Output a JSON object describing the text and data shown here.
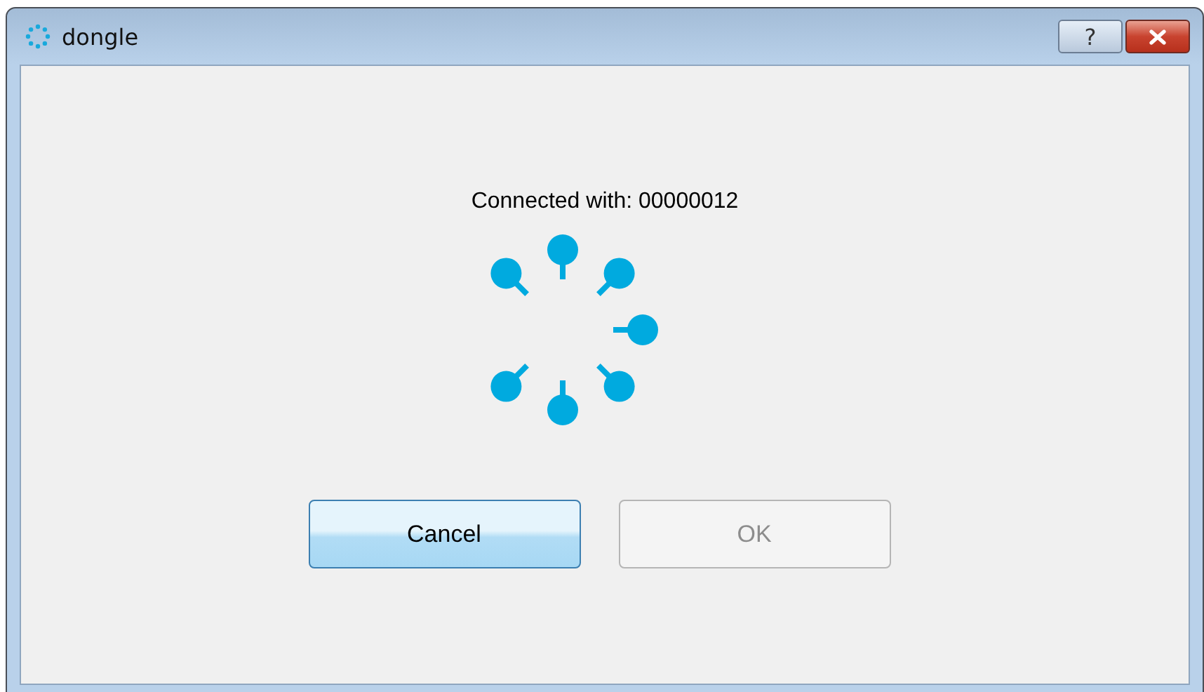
{
  "window": {
    "title": "dongle",
    "help_button": "?"
  },
  "message": "Connected with: 00000012",
  "buttons": [
    {
      "label": "Cancel",
      "disabled": false
    },
    {
      "label": "OK",
      "disabled": true
    }
  ]
}
